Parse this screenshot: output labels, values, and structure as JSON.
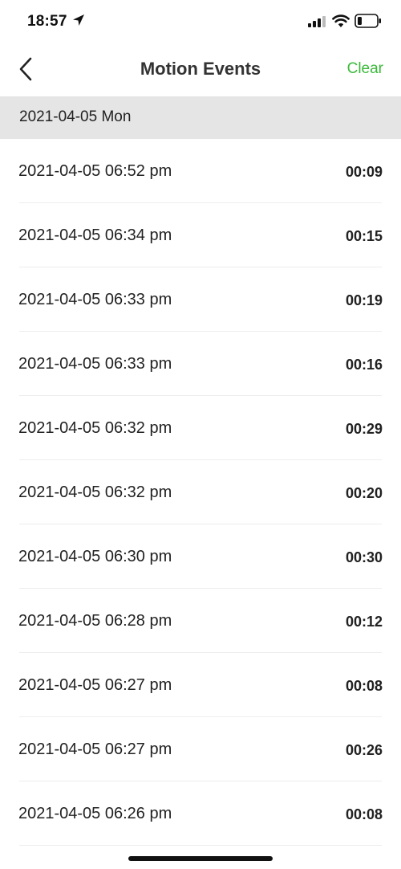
{
  "status_bar": {
    "time": "18:57",
    "icons": [
      "location-arrow-icon",
      "cellular-signal-icon",
      "wifi-icon",
      "battery-icon"
    ]
  },
  "nav": {
    "back_icon": "chevron-left-icon",
    "title": "Motion Events",
    "clear_label": "Clear",
    "accent_color": "#3cba3c"
  },
  "section": {
    "date_label": "2021-04-05 Mon"
  },
  "events": [
    {
      "time": "2021-04-05 06:52 pm",
      "duration": "00:09"
    },
    {
      "time": "2021-04-05 06:34 pm",
      "duration": "00:15"
    },
    {
      "time": "2021-04-05 06:33 pm",
      "duration": "00:19"
    },
    {
      "time": "2021-04-05 06:33 pm",
      "duration": "00:16"
    },
    {
      "time": "2021-04-05 06:32 pm",
      "duration": "00:29"
    },
    {
      "time": "2021-04-05 06:32 pm",
      "duration": "00:20"
    },
    {
      "time": "2021-04-05 06:30 pm",
      "duration": "00:30"
    },
    {
      "time": "2021-04-05 06:28 pm",
      "duration": "00:12"
    },
    {
      "time": "2021-04-05 06:27 pm",
      "duration": "00:08"
    },
    {
      "time": "2021-04-05 06:27 pm",
      "duration": "00:26"
    },
    {
      "time": "2021-04-05 06:26 pm",
      "duration": "00:08"
    }
  ]
}
